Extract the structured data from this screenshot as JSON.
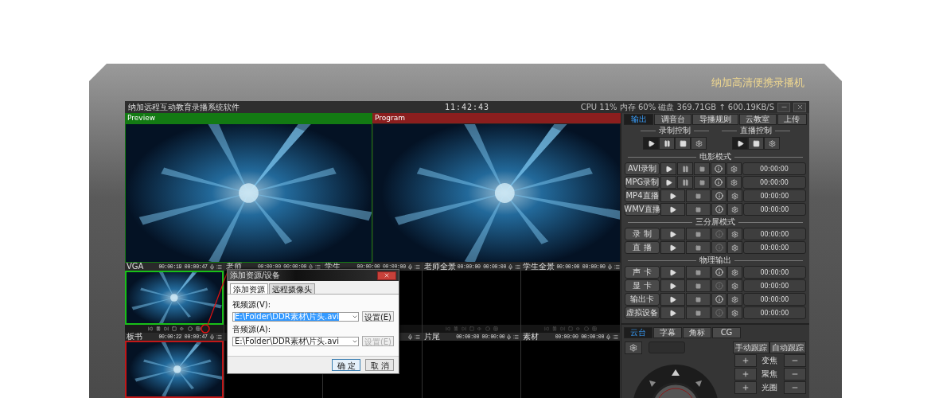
{
  "device": {
    "brand": "纳加高清便携录播机"
  },
  "window": {
    "title": "纳加远程互动教育录播系统软件",
    "clock": "11:42:43",
    "status": "CPU 11% 内存 60% 磁盘 369.71GB ↑ 600.19KB/S"
  },
  "monitors": [
    {
      "label": "Preview",
      "kind": "preview"
    },
    {
      "label": "Program",
      "kind": "program"
    }
  ],
  "source_rows": [
    {
      "sources": [
        {
          "label": "VGA",
          "time": "00:00:19 00:00:47",
          "kind": "preview",
          "controls": true
        },
        {
          "label": "老师",
          "time": "00:00:00 00:00:00",
          "kind": "empty"
        },
        {
          "label": "学生",
          "time": "00:00:00 00:00:00",
          "kind": "empty"
        },
        {
          "label": "老师全景",
          "time": "00:00:00 00:00:00",
          "kind": "empty",
          "controls": true
        },
        {
          "label": "学生全景",
          "time": "00:00:00 00:00:00",
          "kind": "empty",
          "controls": true
        }
      ]
    },
    {
      "sources": [
        {
          "label": "板书",
          "time": "00:00:22 00:00:47",
          "kind": "program"
        },
        {
          "kind": "empty"
        },
        {
          "kind": "empty",
          "icons": true
        },
        {
          "label": "片尾",
          "time": "00:00:00 00:00:00",
          "kind": "empty"
        },
        {
          "label": "素材",
          "time": "00:00:00 00:00:00",
          "kind": "empty"
        }
      ]
    }
  ],
  "dialog": {
    "title": "添加资源/设备",
    "tabs": [
      {
        "label": "添加资源",
        "selected": true
      },
      {
        "label": "远程摄像头",
        "selected": false
      }
    ],
    "fields": [
      {
        "label": "视频源(V):",
        "value": "E:\\Folder\\DDR素材\\片头.avi",
        "highlighted": true,
        "button": "设置(E)",
        "button_disabled": false
      },
      {
        "label": "音频源(A):",
        "value": "E:\\Folder\\DDR素材\\片头.avi",
        "highlighted": false,
        "button": "设置(E)",
        "button_disabled": true
      }
    ],
    "buttons": [
      {
        "label": "确 定",
        "kind": "default"
      },
      {
        "label": "取 消",
        "kind": "normal"
      }
    ]
  },
  "output_panel": {
    "tabs": [
      {
        "label": "输出",
        "selected": true
      },
      {
        "label": "调音台",
        "selected": false
      },
      {
        "label": "导播规则",
        "selected": false
      },
      {
        "label": "云教室",
        "selected": false
      },
      {
        "label": "上传",
        "selected": false
      }
    ],
    "control_groups": [
      {
        "label": "录制控制",
        "buttons": [
          {
            "kind": "play"
          },
          {
            "kind": "pause"
          },
          {
            "kind": "stop"
          },
          {
            "kind": "settings"
          }
        ]
      },
      {
        "label": "直播控制",
        "buttons": [
          {
            "kind": "play"
          },
          {
            "kind": "stop"
          },
          {
            "kind": "settings"
          }
        ]
      }
    ],
    "sections": [
      {
        "label": "电影模式",
        "rows": [
          {
            "label": "AVI录制",
            "kind": "record",
            "info_enabled": true,
            "time": "00:00:00"
          },
          {
            "label": "MPG录制",
            "kind": "record",
            "info_enabled": true,
            "time": "00:00:00"
          },
          {
            "label": "MP4直播",
            "kind": "live",
            "info_enabled": true,
            "time": "00:00:00"
          },
          {
            "label": "WMV直播",
            "kind": "live",
            "info_enabled": true,
            "time": "00:00:00"
          }
        ]
      },
      {
        "label": "三分屏模式",
        "rows": [
          {
            "label": "录 制",
            "kind": "live",
            "info_enabled": false,
            "time": "00:00:00"
          },
          {
            "label": "直 播",
            "kind": "live",
            "info_enabled": false,
            "time": "00:00:00"
          }
        ]
      },
      {
        "label": "物理输出",
        "rows": [
          {
            "label": "声 卡",
            "kind": "live",
            "info_enabled": true,
            "time": "00:00:00"
          },
          {
            "label": "显 卡",
            "kind": "live",
            "info_enabled": false,
            "time": "00:00:00"
          },
          {
            "label": "输出卡",
            "kind": "live",
            "info_enabled": true,
            "time": "00:00:00"
          },
          {
            "label": "虚拟设备",
            "kind": "live",
            "info_enabled": false,
            "time": "00:00:00"
          }
        ]
      }
    ]
  },
  "ptz": {
    "tabs": [
      {
        "label": "云台",
        "selected": true
      },
      {
        "label": "字幕",
        "selected": false
      },
      {
        "label": "角标",
        "selected": false
      },
      {
        "label": "CG",
        "selected": false
      }
    ],
    "tracking": [
      "手动跟踪",
      "自动跟踪"
    ],
    "adjust": [
      "变焦",
      "聚焦",
      "光圈"
    ]
  }
}
